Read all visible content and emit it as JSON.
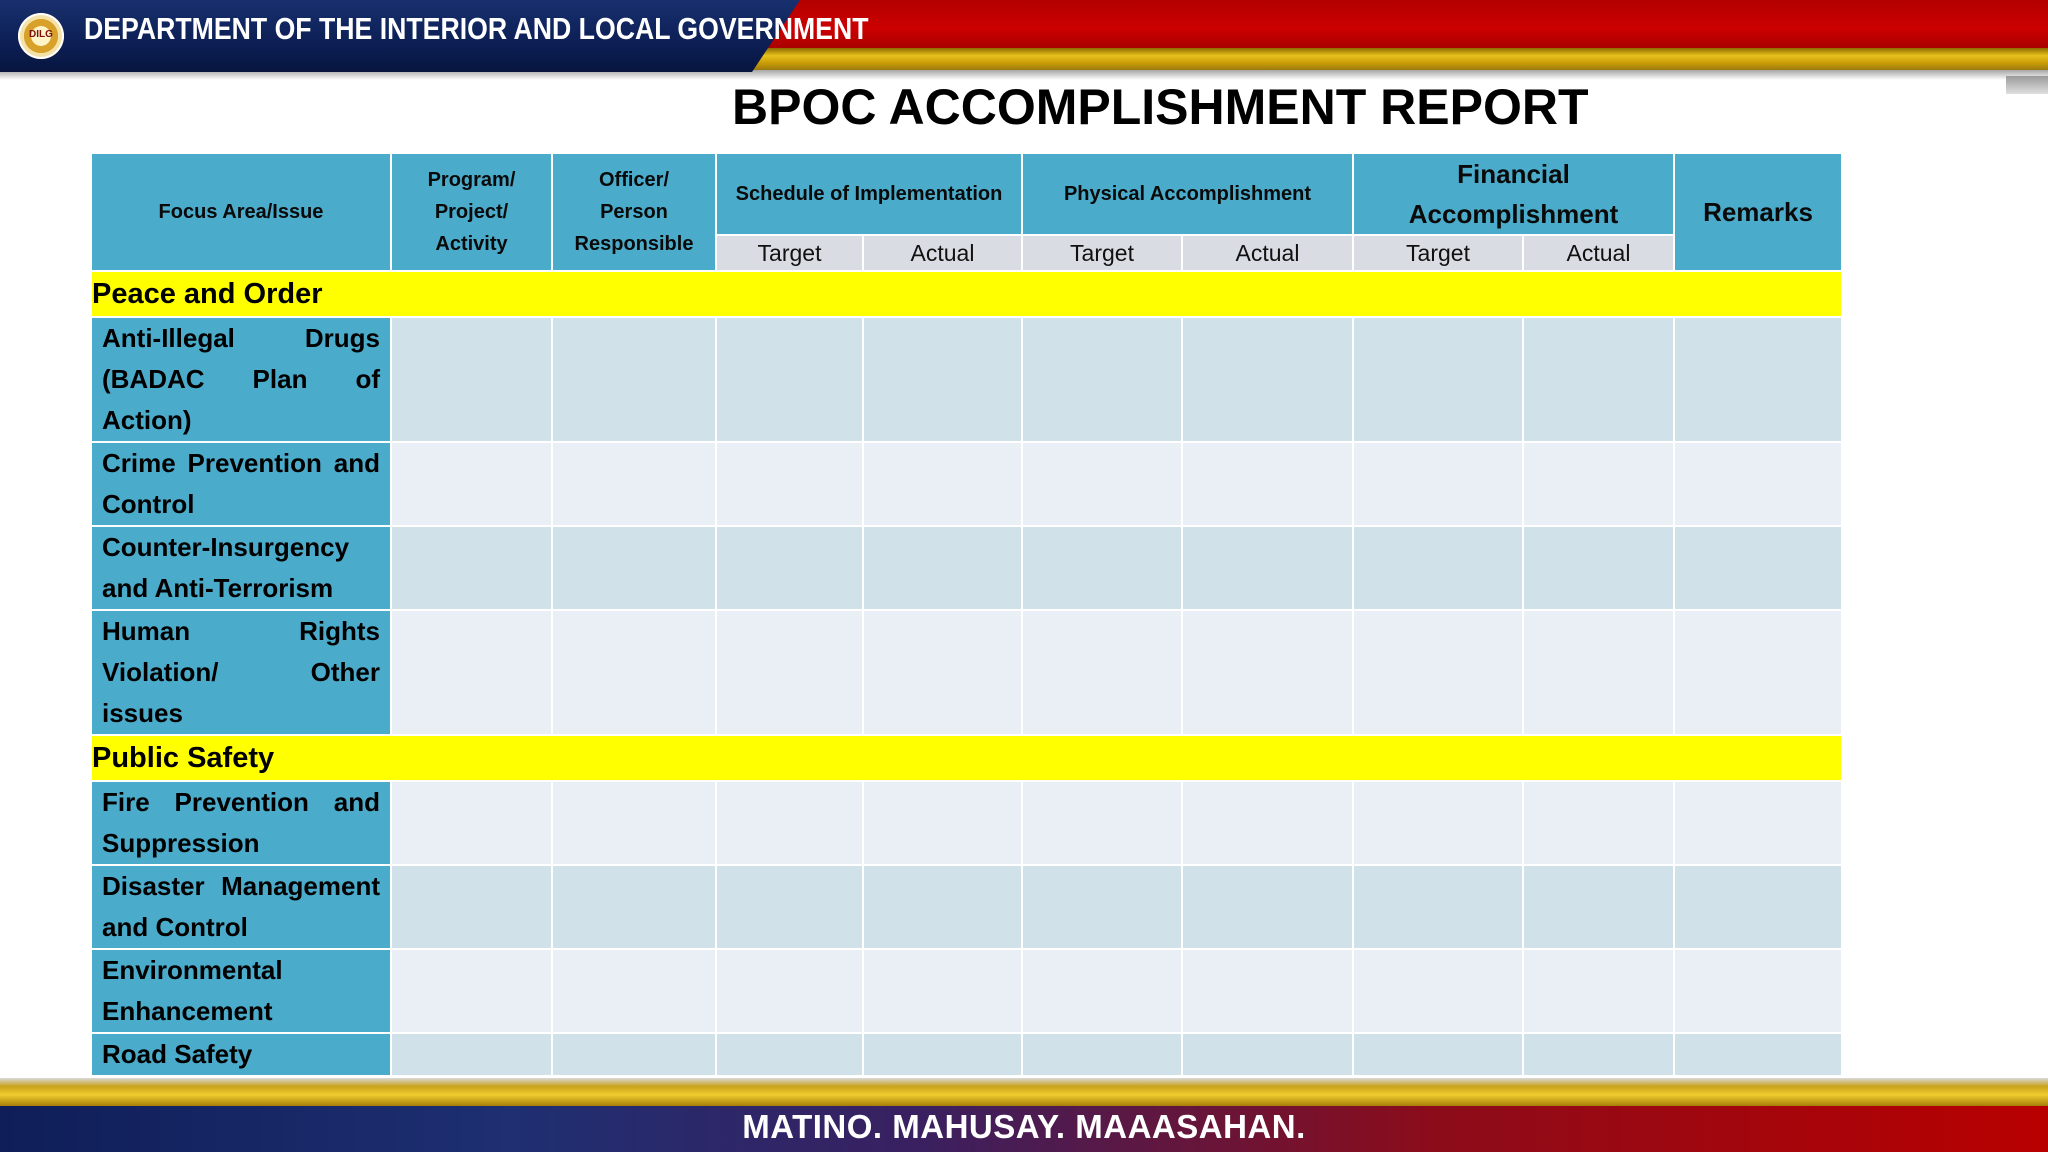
{
  "header": {
    "seal_text": "DILG",
    "department": "DEPARTMENT OF THE INTERIOR AND LOCAL GOVERNMENT"
  },
  "title": "BPOC ACCOMPLISHMENT REPORT",
  "table": {
    "headers": {
      "focus_area": "Focus Area/Issue",
      "program": [
        "Program/",
        "Project/",
        "Activity"
      ],
      "officer": [
        "Officer/",
        "Person",
        "Responsible"
      ],
      "schedule": "Schedule of Implementation",
      "physical": "Physical Accomplishment",
      "financial": [
        "Financial",
        "Accomplishment"
      ],
      "remarks": "Remarks",
      "target": "Target",
      "actual": "Actual"
    },
    "sections": [
      {
        "name": "Peace and Order",
        "items": [
          "Anti-Illegal Drugs (BADAC Plan of Action)",
          "Crime Prevention and Control",
          "Counter-Insurgency and Anti-Terrorism",
          "Human Rights Violation/ Other issues"
        ]
      },
      {
        "name": "Public Safety",
        "items": [
          "Fire Prevention and Suppression",
          "Disaster Management and Control",
          "Environmental Enhancement",
          "Road Safety"
        ]
      }
    ]
  },
  "footer": {
    "motto": "MATINO. MAHUSAY. MAAASAHAN."
  }
}
